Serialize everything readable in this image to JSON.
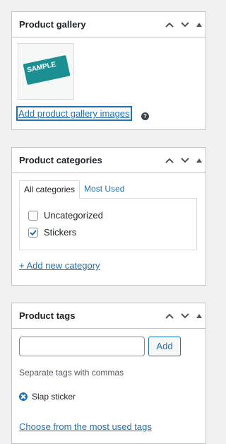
{
  "gallery": {
    "title": "Product gallery",
    "thumb_text": "SAMPLE",
    "add_link": "Add product gallery images",
    "help_icon": "help-icon"
  },
  "categories": {
    "title": "Product categories",
    "tabs": [
      {
        "label": "All categories"
      },
      {
        "label": "Most Used"
      }
    ],
    "items": [
      {
        "label": "Uncategorized",
        "checked": false
      },
      {
        "label": "Stickers",
        "checked": true
      }
    ],
    "add_link": "+ Add new category"
  },
  "tags": {
    "title": "Product tags",
    "input_value": "",
    "add_label": "Add",
    "hint": "Separate tags with commas",
    "tag_list": [
      {
        "label": "Slap sticker"
      }
    ],
    "choose_link": "Choose from the most used tags"
  },
  "colors": {
    "link": "#2271b1",
    "border": "#c3c4c7",
    "background": "#f0f0f1"
  }
}
